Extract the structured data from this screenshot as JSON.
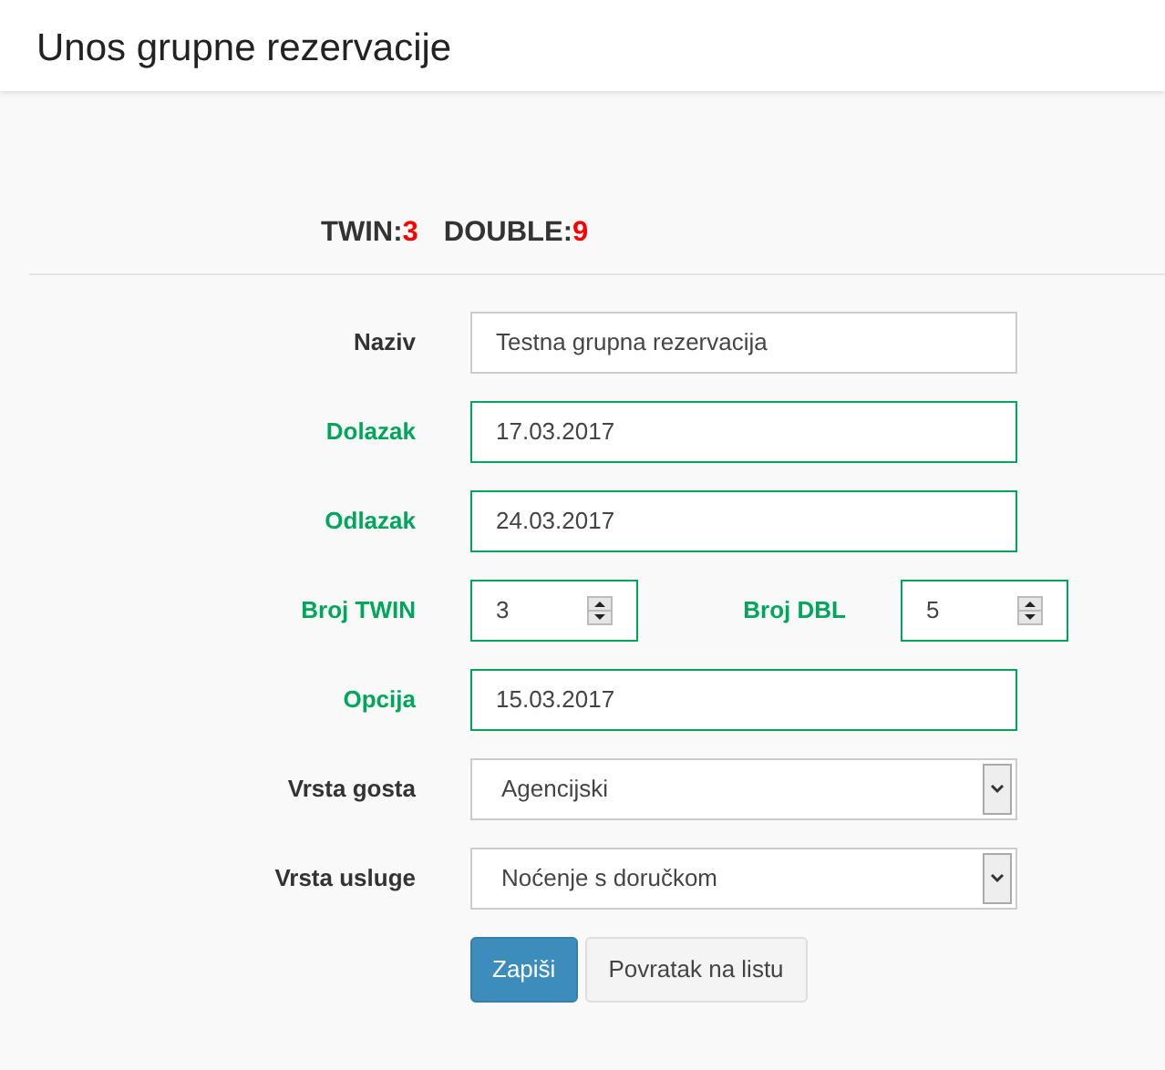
{
  "page_title": "Unos grupne rezervacije",
  "counts": [
    {
      "label": "TWIN:",
      "value": "3"
    },
    {
      "label": "DOUBLE:",
      "value": "9"
    }
  ],
  "fields": [
    {
      "kind": "text",
      "label": "Naziv",
      "value": "Testna grupna rezervacija",
      "valid": false
    },
    {
      "kind": "text",
      "label": "Dolazak",
      "value": "17.03.2017",
      "valid": true
    },
    {
      "kind": "text",
      "label": "Odlazak",
      "value": "24.03.2017",
      "valid": true
    },
    {
      "kind": "number-pair",
      "items": [
        {
          "label": "Broj TWIN",
          "value": "3",
          "valid": true
        },
        {
          "label": "Broj DBL",
          "value": "5",
          "valid": true
        }
      ]
    },
    {
      "kind": "text",
      "label": "Opcija",
      "value": "15.03.2017",
      "valid": true
    },
    {
      "kind": "select",
      "label": "Vrsta gosta",
      "value": "Agencijski",
      "valid": false
    },
    {
      "kind": "select",
      "label": "Vrsta usluge",
      "value": "Noćenje s doručkom",
      "valid": false
    }
  ],
  "buttons": [
    {
      "label": "Zapiši",
      "kind": "primary"
    },
    {
      "label": "Povratak na listu",
      "kind": "default"
    }
  ]
}
